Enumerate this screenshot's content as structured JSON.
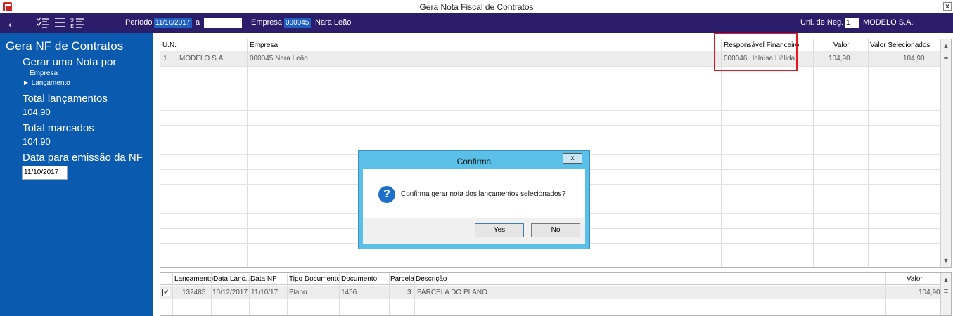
{
  "window": {
    "title": "Gera Nota Fiscal de Contratos",
    "close_label": "x"
  },
  "toolbar": {
    "back_icon": "←",
    "periodo_label": "Período",
    "periodo_inicio": "11/10/2017",
    "periodo_sep": "a",
    "periodo_fim": "",
    "empresa_label": "Empresa",
    "empresa_codigo": "000045",
    "empresa_nome": "Nara Leão",
    "uni_neg_label": "Uni. de Neg.",
    "uni_neg_codigo": "1",
    "uni_neg_nome": "MODELO S.A."
  },
  "sidebar": {
    "title": "Gera NF de Contratos",
    "gerar_label": "Gerar uma Nota por",
    "opcao_empresa": "Empresa",
    "opcao_lancamento": "► Lançamento",
    "total_lancamentos_label": "Total lançamentos",
    "total_lancamentos_valor": "104,90",
    "total_marcados_label": "Total marcados",
    "total_marcados_valor": "104,90",
    "data_emissao_label": "Data para emissão da NF",
    "data_emissao_valor": "11/10/2017"
  },
  "main_grid": {
    "columns": [
      "U.N.",
      "Empresa",
      "Responsável Financeiro",
      "Valor",
      "Valor Selecionados"
    ],
    "row": {
      "un": "1",
      "un_nome": "MODELO S.A.",
      "empresa": "000045  Nara Leão",
      "responsavel": "000046  Heloísa Hélida",
      "valor": "104,90",
      "valor_selecionados": "104,90"
    }
  },
  "bottom_grid": {
    "columns": [
      "Lançamento",
      "Data Lanc...",
      "Data NF",
      "Tipo Documento",
      "Documento",
      "Parcela",
      "Descrição",
      "Valor"
    ],
    "row": {
      "checked": "✔",
      "lancamento": "132485",
      "data_lanc": "10/12/2017",
      "data_nf": "11/10/17",
      "tipo_documento": "Plano",
      "documento": "1456",
      "parcela": "3",
      "descricao": "PARCELA DO PLANO",
      "valor": "104,90"
    }
  },
  "dialog": {
    "title": "Confirma",
    "close_label": "x",
    "icon": "?",
    "message": "Confirma gerar nota dos lançamentos selecionados?",
    "yes_label": "Yes",
    "no_label": "No"
  },
  "colors": {
    "toolbar_bg": "#2c1d6b",
    "sidebar_bg": "#0a5bb0",
    "dialog_frame": "#5bc0e8",
    "highlight": "#e8141e"
  }
}
